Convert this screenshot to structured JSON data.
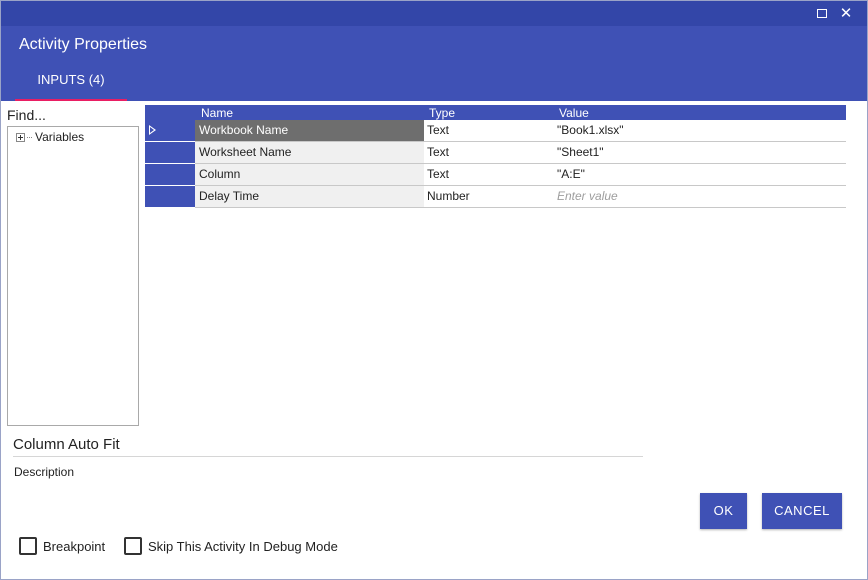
{
  "dialog": {
    "title": "Activity Properties",
    "tab_label": "INPUTS (4)",
    "controls": {
      "maximize_icon": "maximize-icon",
      "close_icon": "close-icon",
      "close_glyph": "✕"
    },
    "colors": {
      "header": "#3f51b5",
      "title_strip": "#3346a8",
      "tab_underline": "#e91e63",
      "selected_row": "#6e6e6e"
    }
  },
  "left_panel": {
    "find_placeholder": "Find...",
    "tree": [
      {
        "label": "Variables",
        "collapsed": true
      }
    ]
  },
  "grid": {
    "columns": [
      "Name",
      "Type",
      "Value"
    ],
    "rows": [
      {
        "name": "Workbook Name",
        "type": "Text",
        "value": "\"Book1.xlsx\"",
        "selected": true
      },
      {
        "name": "Worksheet Name",
        "type": "Text",
        "value": "\"Sheet1\"",
        "selected": false
      },
      {
        "name": "Column",
        "type": "Text",
        "value": "\"A:E\"",
        "selected": false
      },
      {
        "name": "Delay Time",
        "type": "Number",
        "value": "",
        "placeholder": "Enter value",
        "selected": false
      }
    ]
  },
  "activity": {
    "name": "Column Auto Fit",
    "description_label": "Description"
  },
  "buttons": {
    "ok": "OK",
    "cancel": "CANCEL"
  },
  "options": {
    "breakpoint": {
      "label": "Breakpoint",
      "checked": false
    },
    "skip_debug": {
      "label": "Skip This Activity In Debug Mode",
      "checked": false
    }
  }
}
